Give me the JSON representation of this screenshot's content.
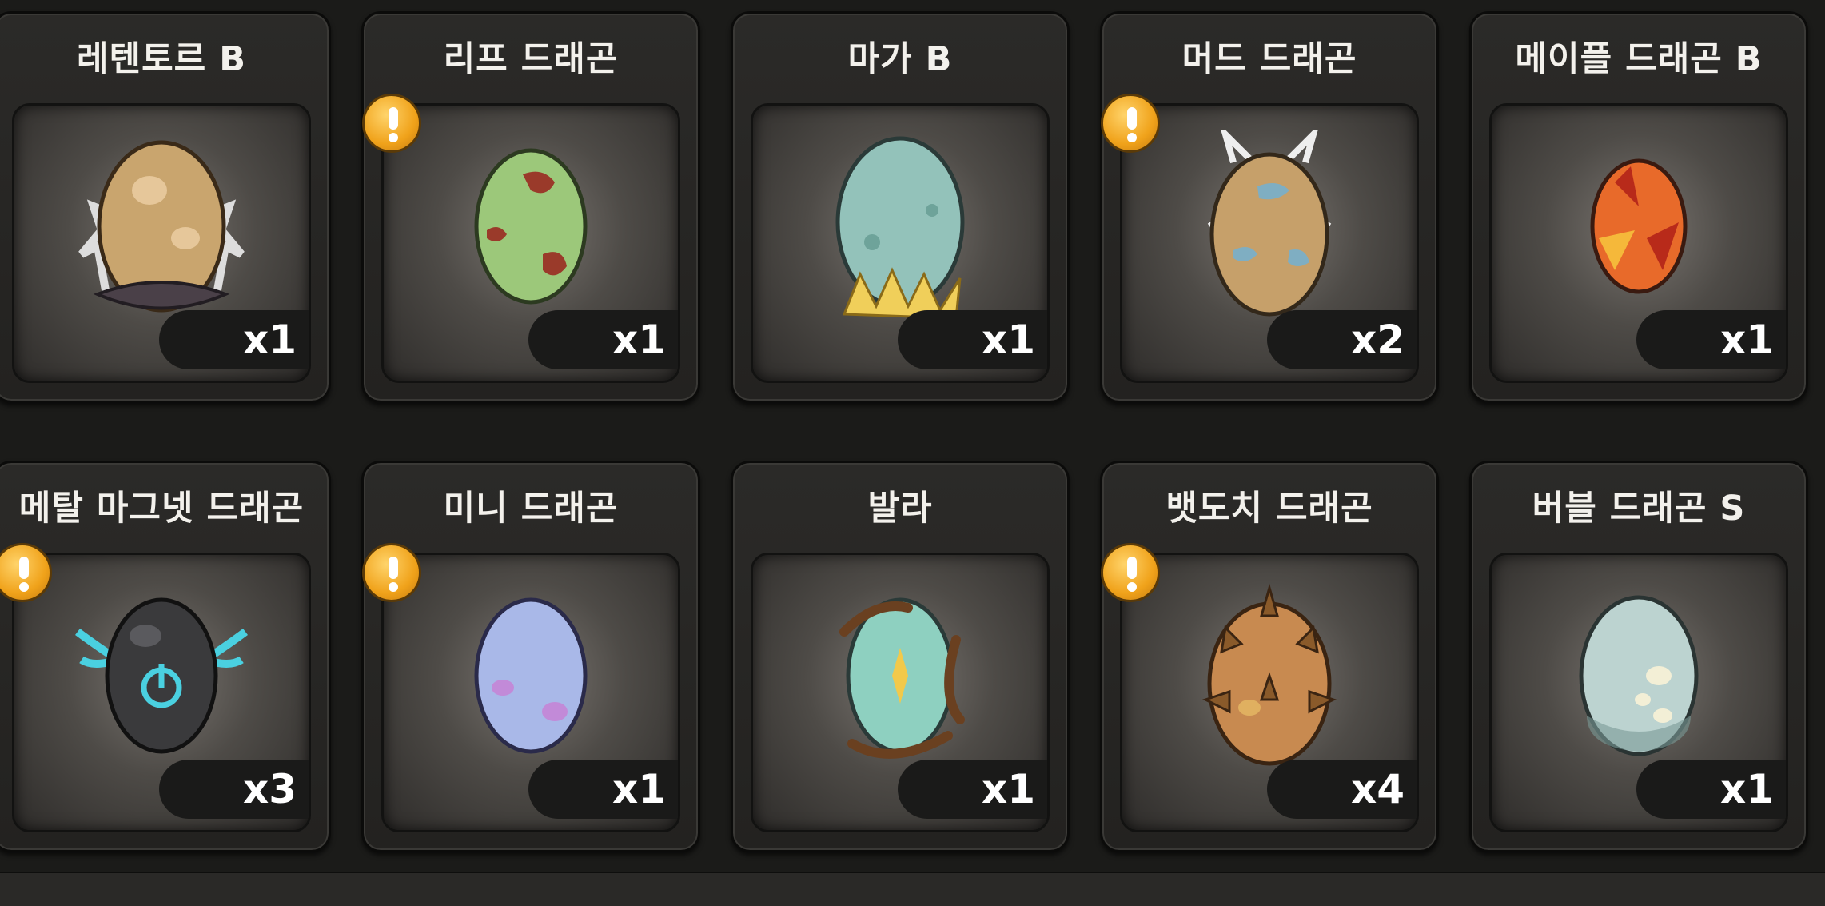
{
  "eggs": [
    {
      "name": "레텐토르 B",
      "count": "x1",
      "alert": false
    },
    {
      "name": "리프 드래곤",
      "count": "x1",
      "alert": true
    },
    {
      "name": "마가 B",
      "count": "x1",
      "alert": false
    },
    {
      "name": "머드 드래곤",
      "count": "x2",
      "alert": true
    },
    {
      "name": "메이플 드래곤 B",
      "count": "x1",
      "alert": false
    },
    {
      "name": "메탈 마그넷 드래곤",
      "count": "x3",
      "alert": true
    },
    {
      "name": "미니 드래곤",
      "count": "x1",
      "alert": true
    },
    {
      "name": "발라",
      "count": "x1",
      "alert": false
    },
    {
      "name": "뱃도치 드래곤",
      "count": "x4",
      "alert": true
    },
    {
      "name": "버블 드래곤 S",
      "count": "x1",
      "alert": false
    }
  ],
  "colors": {
    "background": "#1b1b19",
    "alert": "#f0a21a",
    "text": "#f3f1ec"
  }
}
